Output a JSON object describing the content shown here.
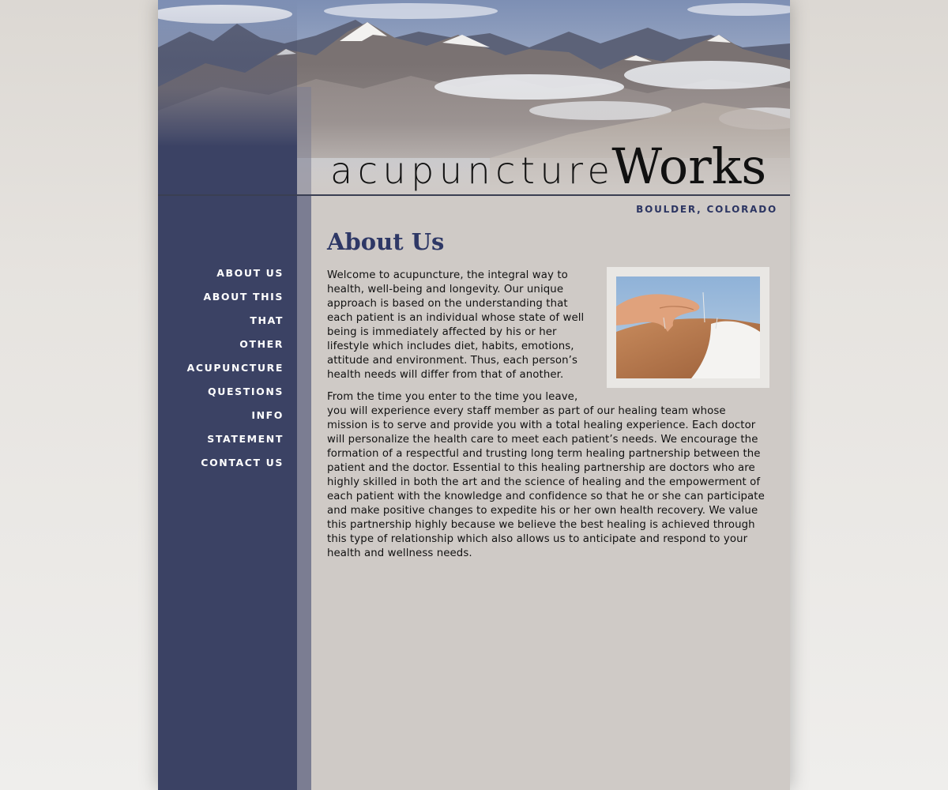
{
  "brand": {
    "logo_light": "acupuncture",
    "logo_bold": "Works",
    "location": "BOULDER, COLORADO"
  },
  "nav": {
    "items": [
      "ABOUT US",
      "ABOUT THIS",
      "THAT",
      "OTHER",
      "ACUPUNCTURE",
      "QUESTIONS",
      "INFO",
      "STATEMENT",
      "CONTACT US"
    ]
  },
  "main": {
    "title": "About Us",
    "paragraph1": "Welcome to acupuncture, the integral way to health, well-being and longevity. Our unique approach is based on the understanding that each patient is an individual whose state of well being is immediately affected by his or her lifestyle which includes diet, habits, emotions, attitude and environment. Thus, each person’s health needs will differ from that of another.",
    "paragraph2": "From the time you enter to the time you leave, you will experience every staff member as part of our healing team whose mission is to serve and provide you with a total healing experience. Each doctor will personalize the health care to meet each patient’s needs. We encourage the formation of a respectful and trusting long term healing part­nership between the patient and the doctor. Essential to this healing partnership are doctors who are highly skilled in both the art and the science of healing and the empowerment of each patient with the knowledge and confidence so that he or she can participate and make positive changes to expedite his or her own health recovery. We value this partnership highly because we believe the best healing is achieved through this type of relationship which also allows us to anticipate and respond to your health and wellness needs."
  },
  "colors": {
    "sidebar": "#3b4264",
    "stripe": "#7b7d92",
    "content_bg": "#cfcac6",
    "title": "#2e3866"
  },
  "icons": {
    "header_image": "mountain-landscape",
    "photo": "acupuncture-treatment-photo"
  }
}
